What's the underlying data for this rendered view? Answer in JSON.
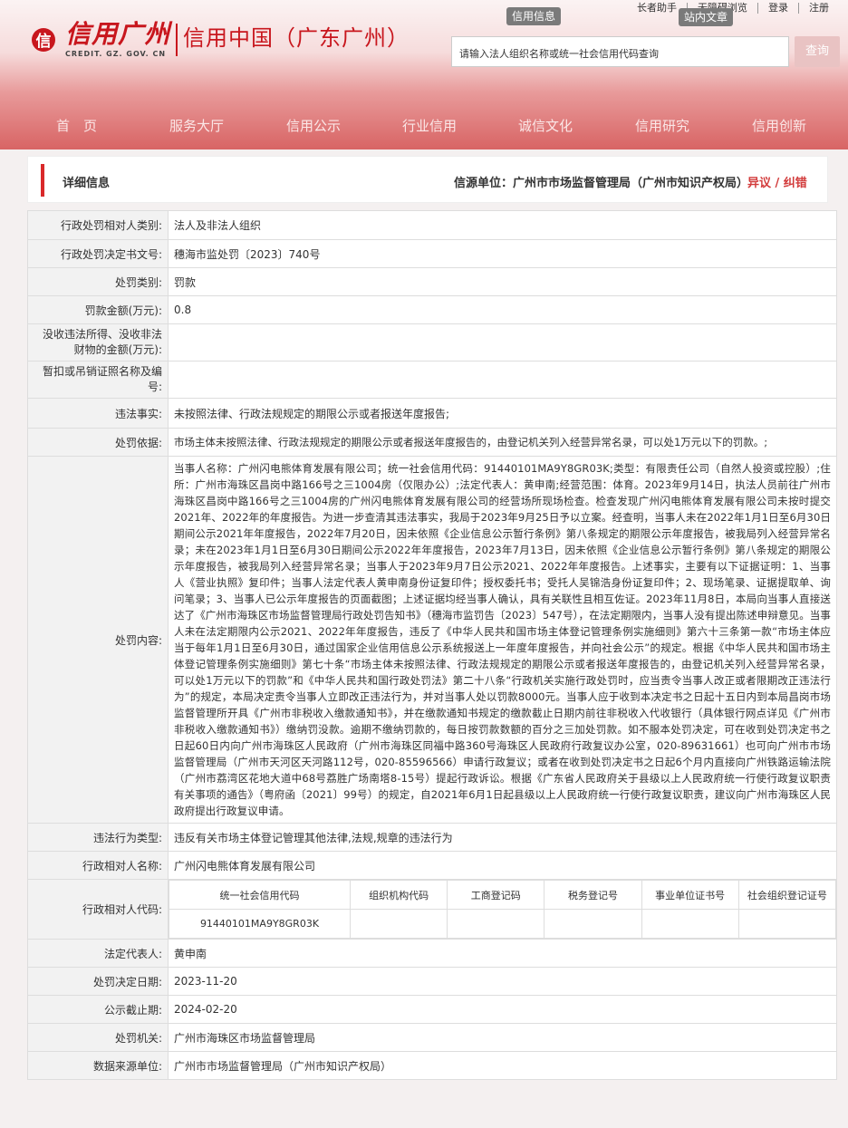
{
  "header": {
    "top_links": [
      "长者助手",
      "无障碍浏览",
      "登录",
      "注册"
    ],
    "tag_credit_info": "信用信息",
    "tag_site_search": "站内文章",
    "logo_main": "信用广州",
    "logo_sub": "CREDIT. GZ. GOV. CN",
    "logo_right": "信用中国（广东广州）",
    "search_placeholder": "请输入法人组织名称或统一社会信用代码查询",
    "search_button": "查询",
    "nav": [
      "首　页",
      "服务大厅",
      "信用公示",
      "行业信用",
      "诚信文化",
      "信用研究",
      "信用创新"
    ]
  },
  "card": {
    "title": "详细信息",
    "source": "信源单位：广州市市场监督管理局（广州市知识产权局）",
    "report": "异议 / 纠错"
  },
  "rows": {
    "party_type": {
      "label": "行政处罚相对人类别:",
      "value": "法人及非法人组织"
    },
    "doc_no": {
      "label": "行政处罚决定书文号:",
      "value": "穗海市监处罚〔2023〕740号"
    },
    "penalty_type": {
      "label": "处罚类别:",
      "value": "罚款"
    },
    "fine": {
      "label": "罚款金额(万元):",
      "value": "0.8"
    },
    "confiscation": {
      "label": "没收违法所得、没收非法财物的金额(万元):",
      "value": ""
    },
    "license": {
      "label": "暂扣或吊销证照名称及编号:",
      "value": ""
    },
    "facts": {
      "label": "违法事实:",
      "value": "未按照法律、行政法规规定的期限公示或者报送年度报告;"
    },
    "basis": {
      "label": "处罚依据:",
      "value": "市场主体未按照法律、行政法规规定的期限公示或者报送年度报告的，由登记机关列入经营异常名录，可以处1万元以下的罚款。;"
    },
    "content": {
      "label": "处罚内容:",
      "value": "当事人名称：广州闪电熊体育发展有限公司；统一社会信用代码：91440101MA9Y8GR03K;类型：有限责任公司（自然人投资或控股）;住所：广州市海珠区昌岗中路166号之三1004房（仅限办公）;法定代表人：黄申南;经营范围：体育。2023年9月14日，执法人员前往广州市海珠区昌岗中路166号之三1004房的广州闪电熊体育发展有限公司的经营场所现场检查。检查发现广州闪电熊体育发展有限公司未按时提交2021年、2022年的年度报告。为进一步查清其违法事实，我局于2023年9月25日予以立案。经查明，当事人未在2022年1月1日至6月30日期间公示2021年年度报告，2022年7月20日，因未依照《企业信息公示暂行条例》第八条规定的期限公示年度报告，被我局列入经营异常名录；未在2023年1月1日至6月30日期间公示2022年年度报告，2023年7月13日，因未依照《企业信息公示暂行条例》第八条规定的期限公示年度报告，被我局列入经营异常名录；当事人于2023年9月7日公示2021、2022年年度报告。上述事实，主要有以下证据证明：1、当事人《营业执照》复印件；当事人法定代表人黄申南身份证复印件；授权委托书；受托人吴锦浩身份证复印件；2、现场笔录、证据提取单、询问笔录；3、当事人已公示年度报告的页面截图；上述证据均经当事人确认，具有关联性且相互佐证。2023年11月8日，本局向当事人直接送达了《广州市海珠区市场监督管理局行政处罚告知书》（穗海市监罚告〔2023〕547号），在法定期限内，当事人没有提出陈述申辩意见。当事人未在法定期限内公示2021、2022年年度报告，违反了《中华人民共和国市场主体登记管理条例实施细则》第六十三条第一款“市场主体应当于每年1月1日至6月30日，通过国家企业信用信息公示系统报送上一年度年度报告，并向社会公示”的规定。根据《中华人民共和国市场主体登记管理条例实施细则》第七十条“市场主体未按照法律、行政法规规定的期限公示或者报送年度报告的，由登记机关列入经营异常名录，可以处1万元以下的罚款”和《中华人民共和国行政处罚法》第二十八条“行政机关实施行政处罚时，应当责令当事人改正或者限期改正违法行为”的规定，本局决定责令当事人立即改正违法行为，并对当事人处以罚款8000元。当事人应于收到本决定书之日起十五日内到本局昌岗市场监督管理所开具《广州市非税收入缴款通知书》，并在缴款通知书规定的缴款截止日期内前往非税收入代收银行（具体银行网点详见《广州市非税收入缴款通知书》）缴纳罚没款。逾期不缴纳罚款的，每日按罚款数额的百分之三加处罚款。如不服本处罚决定，可在收到处罚决定书之日起60日内向广州市海珠区人民政府（广州市海珠区同福中路360号海珠区人民政府行政复议办公室，020-89631661）也可向广州市市场监督管理局（广州市天河区天河路112号，020-85596566）申请行政复议；或者在收到处罚决定书之日起6个月内直接向广州铁路运输法院（广州市荔湾区花地大道中68号荔胜广场南塔8-15号）提起行政诉讼。根据《广东省人民政府关于县级以上人民政府统一行使行政复议职责有关事项的通告》（粤府函〔2021〕99号）的规定，自2021年6月1日起县级以上人民政府统一行使行政复议职责，建议向广州市海珠区人民政府提出行政复议申请。"
    },
    "violation_type": {
      "label": "违法行为类型:",
      "value": "违反有关市场主体登记管理其他法律,法规,规章的违法行为"
    },
    "party_name": {
      "label": "行政相对人名称:",
      "value": "广州闪电熊体育发展有限公司"
    },
    "party_code": {
      "label": "行政相对人代码:",
      "headers": [
        "统一社会信用代码",
        "组织机构代码",
        "工商登记码",
        "税务登记号",
        "事业单位证书号",
        "社会组织登记证号"
      ],
      "values": [
        "91440101MA9Y8GR03K",
        "",
        "",
        "",
        "",
        ""
      ]
    },
    "legal_rep": {
      "label": "法定代表人:",
      "value": "黄申南"
    },
    "decision_date": {
      "label": "处罚决定日期:",
      "value": "2023-11-20"
    },
    "publish_end": {
      "label": "公示截止期:",
      "value": "2024-02-20"
    },
    "authority": {
      "label": "处罚机关:",
      "value": "广州市海珠区市场监督管理局"
    },
    "data_source": {
      "label": "数据来源单位:",
      "value": "广州市市场监督管理局（广州市知识产权局）"
    }
  }
}
